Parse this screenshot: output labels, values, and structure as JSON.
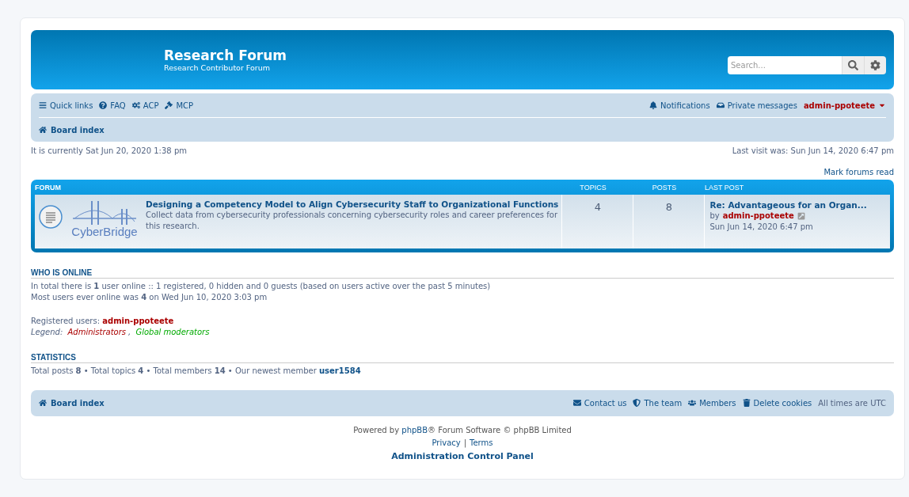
{
  "header": {
    "title": "Research Forum",
    "subtitle": "Research Contributor Forum",
    "search": {
      "placeholder": "Search..."
    }
  },
  "navbar": {
    "links": [
      "Quick links",
      "FAQ",
      "ACP",
      "MCP"
    ],
    "right_links": [
      "Notifications",
      "Private messages"
    ],
    "user": "admin-ppoteete",
    "breadcrumb": "Board index"
  },
  "current_time": "It is currently Sat Jun 20, 2020 1:38 pm",
  "last_visit": "Last visit was: Sun Jun 14, 2020 6:47 pm",
  "mark_read": "Mark forums read",
  "forum_table": {
    "columns": [
      "FORUM",
      "TOPICS",
      "POSTS",
      "LAST POST"
    ],
    "rows": [
      {
        "logo_text": "CyberBridge",
        "title": "Designing a Competency Model to Align Cybersecurity Staff to Organizational Functions",
        "description": "Collect data from cybersecurity professionals concerning cybersecurity roles and career preferences for this research.",
        "topics": "4",
        "posts": "8",
        "last_post_title": "Re: Advantageous for an Organ...",
        "last_post_by": "by",
        "last_post_user": "admin-ppoteete",
        "last_post_time": "Sun Jun 14, 2020 6:47 pm"
      }
    ]
  },
  "who_is_online": {
    "heading": "WHO IS ONLINE",
    "lines": [
      "In total there is **1** user online :: 1 registered, 0 hidden and 0 guests (based on users active over the past 5 minutes)",
      "Most users ever online was **4** on Wed Jun 10, 2020 3:03 pm"
    ],
    "registered_label": "Registered users:",
    "registered_user": "admin-ppoteete",
    "legend_label": "Legend:",
    "legend_separator": ",",
    "legend": [
      {
        "label": "Administrators",
        "color": "#aa0000"
      },
      {
        "label": "Global moderators",
        "color": "#00aa00"
      }
    ]
  },
  "statistics": {
    "heading": "STATISTICS",
    "line": "Total posts **8** • Total topics **4** • Total members **14** • Our newest member",
    "newest_member": "user1584"
  },
  "footer_nav": {
    "breadcrumb": "Board index",
    "links": [
      "Contact us",
      "The team",
      "Members",
      "Delete cookies"
    ],
    "timezone": "All times are UTC"
  },
  "copyright": {
    "before": "Powered by",
    "link": "phpBB",
    "after": "® Forum Software © phpBB Limited",
    "privacy": "Privacy",
    "separator": "|",
    "terms": "Terms",
    "acp": "Administration Control Panel"
  }
}
